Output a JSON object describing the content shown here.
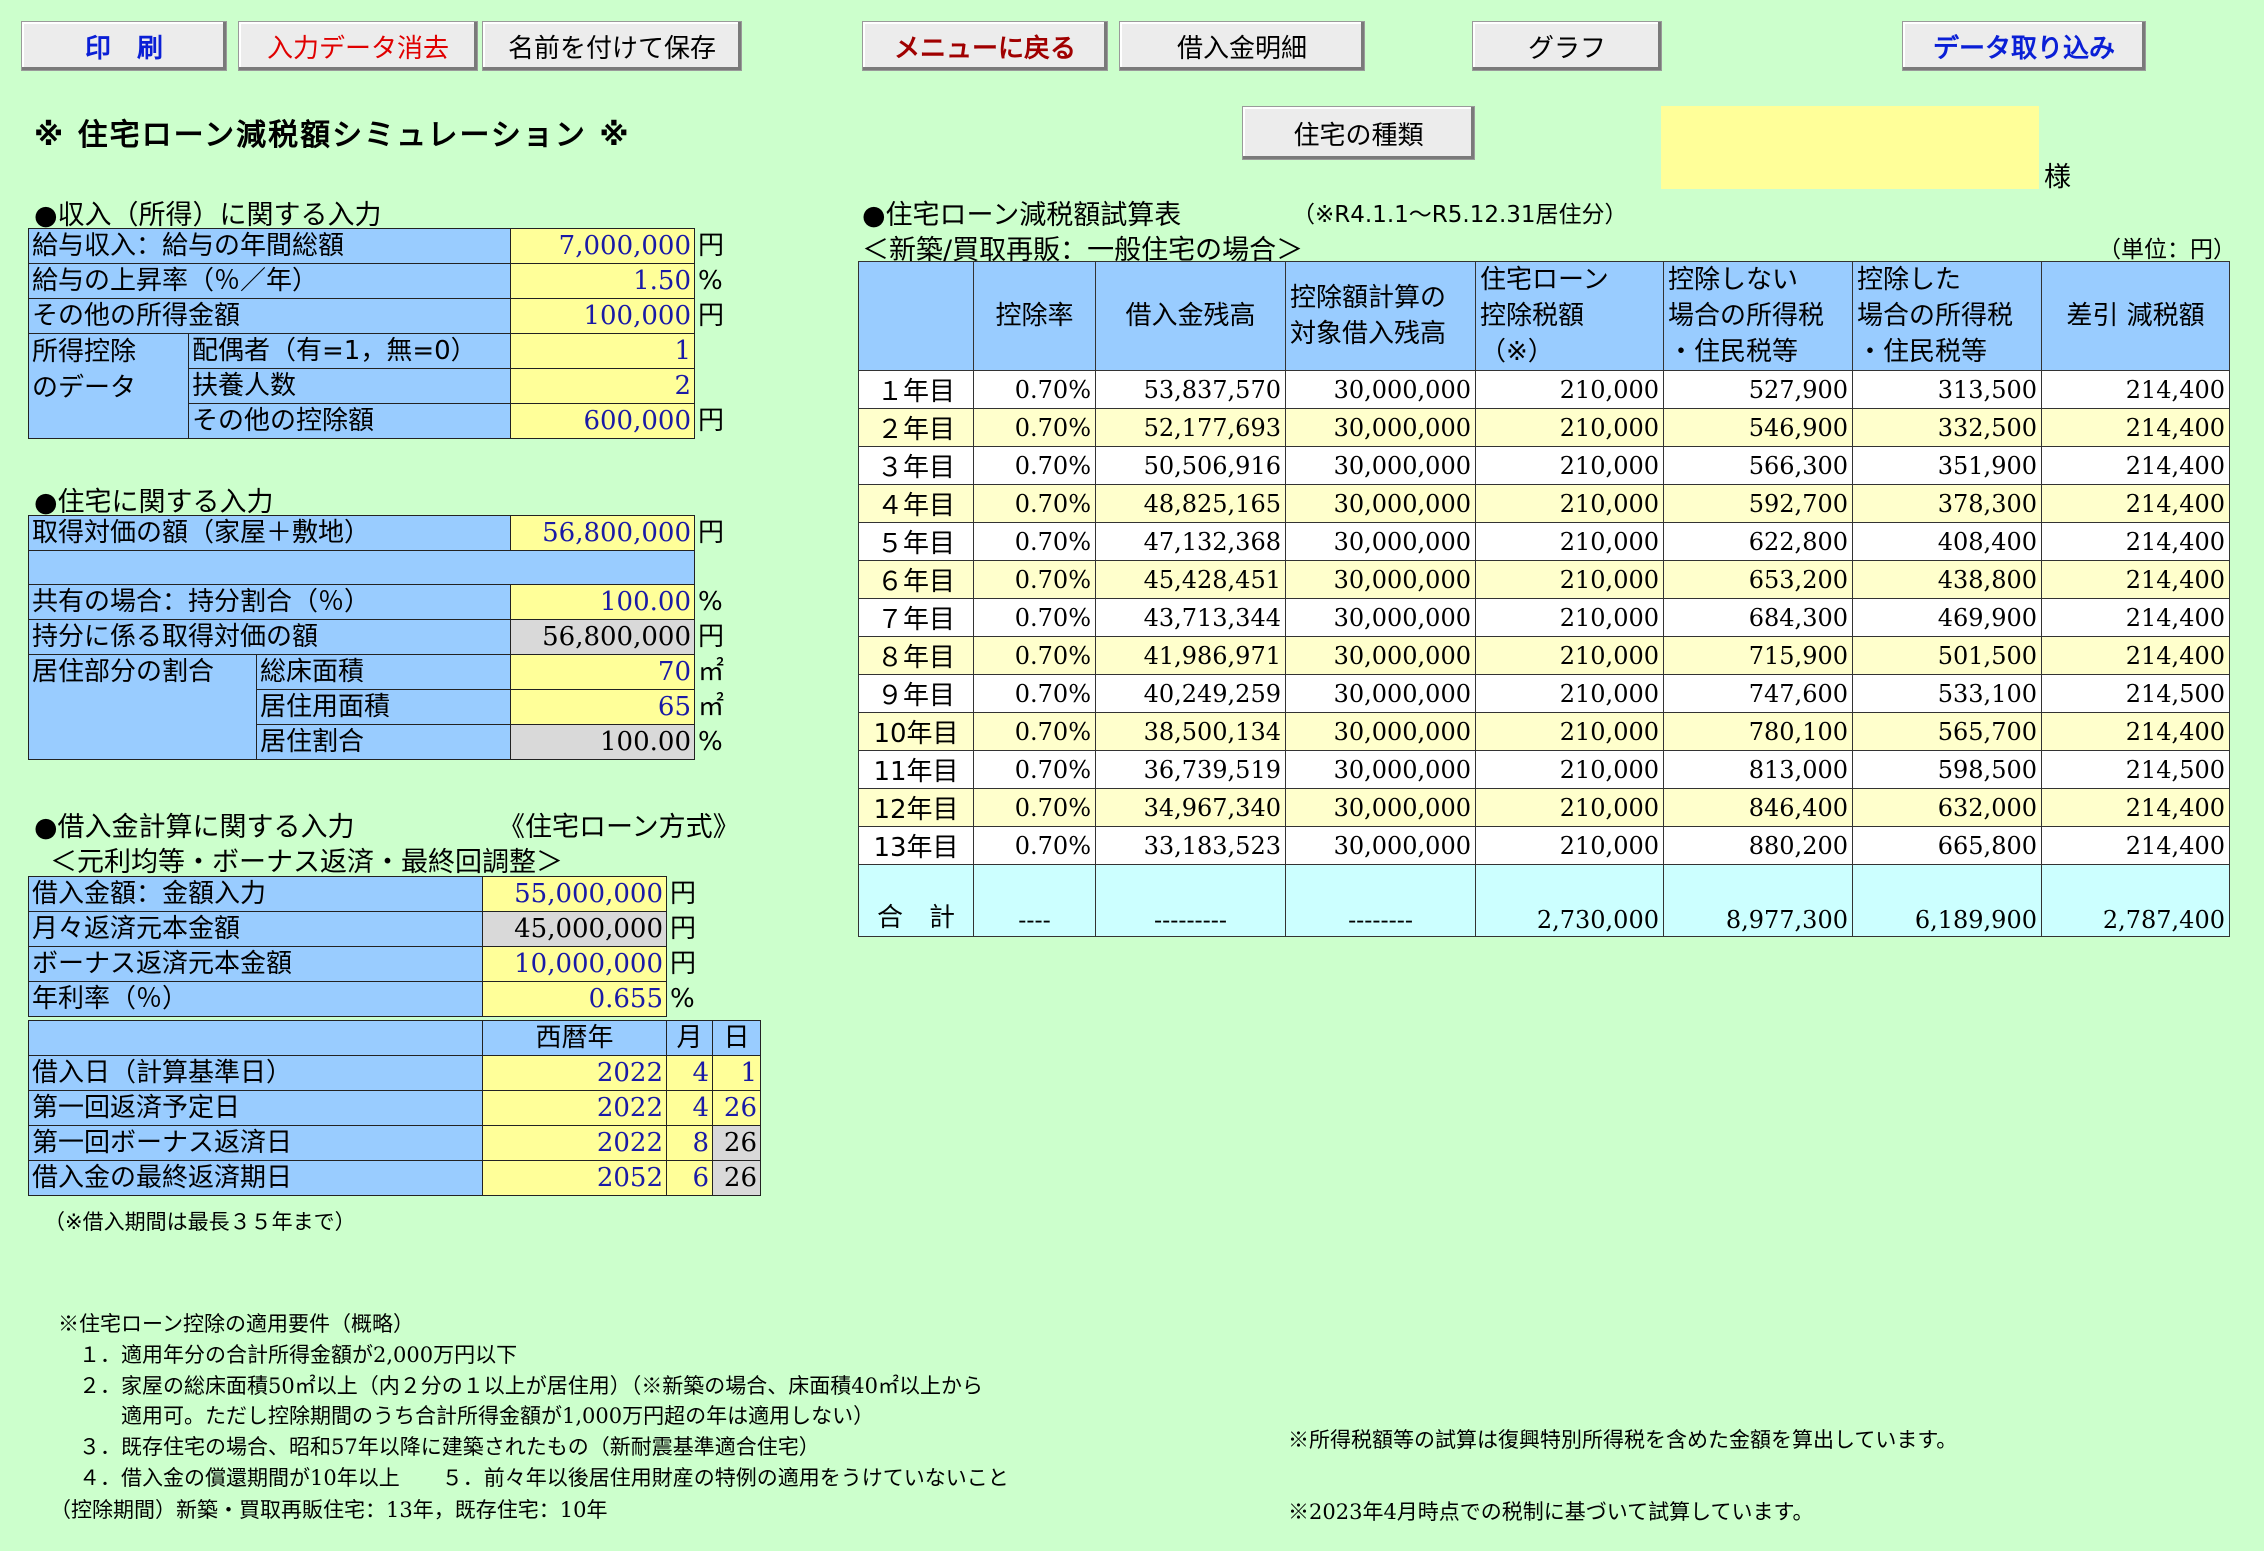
{
  "toolbar": {
    "print": "印　刷",
    "clear": "入力データ消去",
    "save_as": "名前を付けて保存",
    "menu": "メニューに戻る",
    "loan_detail": "借入金明細",
    "graph": "グラフ",
    "import": "データ取り込み",
    "house_type": "住宅の種類"
  },
  "page": {
    "title": "※ 住宅ローン減税額シミュレーション ※",
    "name_suffix": "様"
  },
  "income": {
    "section": "●収入（所得）に関する入力",
    "rows": [
      {
        "label": "給与収入：給与の年間総額",
        "value": "7,000,000",
        "unit": "円"
      },
      {
        "label": "給与の上昇率（％／年）",
        "value": "1.50",
        "unit": "%"
      },
      {
        "label": "その他の所得金額",
        "value": "100,000",
        "unit": "円"
      }
    ],
    "deduction_group": "所得控除\nのデータ",
    "deductions": [
      {
        "label": "配偶者（有=1，無=0）",
        "value": "1",
        "unit": ""
      },
      {
        "label": "扶養人数",
        "value": "2",
        "unit": ""
      },
      {
        "label": "その他の控除額",
        "value": "600,000",
        "unit": "円"
      }
    ]
  },
  "house": {
    "section": "●住宅に関する入力",
    "price_label": "取得対価の額（家屋＋敷地）",
    "price_value": "56,800,000",
    "price_unit": "円",
    "share_label": "共有の場合：持分割合（％）",
    "share_value": "100.00",
    "share_unit": "%",
    "share_price_label": "持分に係る取得対価の額",
    "share_price_value": "56,800,000",
    "share_price_unit": "円",
    "residence_group": "居住部分の割合",
    "residence": [
      {
        "label": "総床面積",
        "value": "70",
        "unit": "㎡"
      },
      {
        "label": "居住用面積",
        "value": "65",
        "unit": "㎡"
      },
      {
        "label": "居住割合",
        "value": "100.00",
        "unit": "%"
      }
    ]
  },
  "loan": {
    "section": "●借入金計算に関する入力",
    "method": "《住宅ローン方式》",
    "sub": "＜元利均等・ボーナス返済・最終回調整＞",
    "rows": [
      {
        "label": "借入金額：金額入力",
        "value": "55,000,000",
        "unit": "円"
      },
      {
        "label": "月々返済元本金額",
        "value": "45,000,000",
        "unit": "円"
      },
      {
        "label": "ボーナス返済元本金額",
        "value": "10,000,000",
        "unit": "円"
      },
      {
        "label": "年利率（％）",
        "value": "0.655",
        "unit": "%"
      }
    ],
    "date_headers": {
      "year": "西暦年",
      "month": "月",
      "day": "日"
    },
    "dates": [
      {
        "label": "借入日（計算基準日）",
        "year": "2022",
        "month": "4",
        "day": "1"
      },
      {
        "label": "第一回返済予定日",
        "year": "2022",
        "month": "4",
        "day": "26"
      },
      {
        "label": "第一回ボーナス返済日",
        "year": "2022",
        "month": "8",
        "day": "26"
      },
      {
        "label": "借入金の最終返済期日",
        "year": "2052",
        "month": "6",
        "day": "26"
      }
    ],
    "note": "（※借入期間は最長３５年まで）"
  },
  "calc": {
    "section": "●住宅ローン減税額試算表",
    "period": "（※R4.1.1～R5.12.31居住分）",
    "case": "＜新築/買取再販：一般住宅の場合＞",
    "unit": "（単位：円）",
    "headers": [
      "控除率",
      "借入金残高",
      "控除額計算の\n対象借入残高",
      "住宅ローン\n控除税額\n（※）",
      "控除しない\n場合の所得税\n・住民税等",
      "控除した\n場合の所得税\n・住民税等",
      "差引 減税額"
    ],
    "rows": [
      {
        "year": "１年目",
        "rate": "0.70%",
        "balance": "53,837,570",
        "target": "30,000,000",
        "credit": "210,000",
        "without": "527,900",
        "with": "313,500",
        "diff": "214,400"
      },
      {
        "year": "２年目",
        "rate": "0.70%",
        "balance": "52,177,693",
        "target": "30,000,000",
        "credit": "210,000",
        "without": "546,900",
        "with": "332,500",
        "diff": "214,400"
      },
      {
        "year": "３年目",
        "rate": "0.70%",
        "balance": "50,506,916",
        "target": "30,000,000",
        "credit": "210,000",
        "without": "566,300",
        "with": "351,900",
        "diff": "214,400"
      },
      {
        "year": "４年目",
        "rate": "0.70%",
        "balance": "48,825,165",
        "target": "30,000,000",
        "credit": "210,000",
        "without": "592,700",
        "with": "378,300",
        "diff": "214,400"
      },
      {
        "year": "５年目",
        "rate": "0.70%",
        "balance": "47,132,368",
        "target": "30,000,000",
        "credit": "210,000",
        "without": "622,800",
        "with": "408,400",
        "diff": "214,400"
      },
      {
        "year": "６年目",
        "rate": "0.70%",
        "balance": "45,428,451",
        "target": "30,000,000",
        "credit": "210,000",
        "without": "653,200",
        "with": "438,800",
        "diff": "214,400"
      },
      {
        "year": "７年目",
        "rate": "0.70%",
        "balance": "43,713,344",
        "target": "30,000,000",
        "credit": "210,000",
        "without": "684,300",
        "with": "469,900",
        "diff": "214,400"
      },
      {
        "year": "８年目",
        "rate": "0.70%",
        "balance": "41,986,971",
        "target": "30,000,000",
        "credit": "210,000",
        "without": "715,900",
        "with": "501,500",
        "diff": "214,400"
      },
      {
        "year": "９年目",
        "rate": "0.70%",
        "balance": "40,249,259",
        "target": "30,000,000",
        "credit": "210,000",
        "without": "747,600",
        "with": "533,100",
        "diff": "214,500"
      },
      {
        "year": "10年目",
        "rate": "0.70%",
        "balance": "38,500,134",
        "target": "30,000,000",
        "credit": "210,000",
        "without": "780,100",
        "with": "565,700",
        "diff": "214,400"
      },
      {
        "year": "11年目",
        "rate": "0.70%",
        "balance": "36,739,519",
        "target": "30,000,000",
        "credit": "210,000",
        "without": "813,000",
        "with": "598,500",
        "diff": "214,500"
      },
      {
        "year": "12年目",
        "rate": "0.70%",
        "balance": "34,967,340",
        "target": "30,000,000",
        "credit": "210,000",
        "without": "846,400",
        "with": "632,000",
        "diff": "214,400"
      },
      {
        "year": "13年目",
        "rate": "0.70%",
        "balance": "33,183,523",
        "target": "30,000,000",
        "credit": "210,000",
        "without": "880,200",
        "with": "665,800",
        "diff": "214,400"
      }
    ],
    "total": {
      "label": "合　計",
      "rate": "----",
      "balance": "---------",
      "target": "--------",
      "credit": "2,730,000",
      "without": "8,977,300",
      "with": "6,189,900",
      "diff": "2,787,400"
    }
  },
  "notes": {
    "requirements": [
      "※住宅ローン控除の適用要件（概略）",
      "　１．適用年分の合計所得金額が2,000万円以下",
      "　２．家屋の総床面積50㎡以上（内２分の１以上が居住用）（※新築の場合、床面積40㎡以上から",
      "　　　適用可。ただし控除期間のうち合計所得金額が1,000万円超の年は適用しない）",
      "　３．既存住宅の場合、昭和57年以降に建築されたもの（新耐震基準適合住宅）",
      "　４．借入金の償還期間が10年以上　　５．前々年以後居住用財産の特例の適用をうけていないこと",
      "（控除期間）新築・買取再販住宅：13年，既存住宅：10年"
    ],
    "tax_note1": "※所得税額等の試算は復興特別所得税を含めた金額を算出しています。",
    "tax_note2": "※2023年4月時点での税制に基づいて試算しています。"
  }
}
